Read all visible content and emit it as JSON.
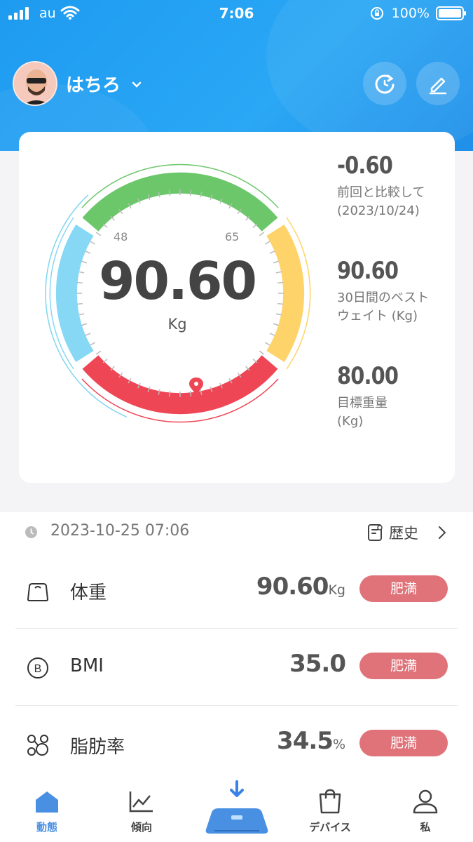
{
  "status": {
    "carrier": "au",
    "time": "7:06",
    "battery": "100%"
  },
  "profile": {
    "name": "はちろ"
  },
  "gauge": {
    "value": "90.60",
    "unit": "Kg",
    "tick_low": "48",
    "tick_high": "65"
  },
  "stats": [
    {
      "value": "-0.60",
      "label_line1": "前回と比較して",
      "label_line2": "(2023/10/24)"
    },
    {
      "value": "90.60",
      "label_line1": "30日間のベスト",
      "label_line2": "ウェイト (Kg)"
    },
    {
      "value": "80.00",
      "label_line1": "目標重量",
      "label_line2": "(Kg)"
    }
  ],
  "record": {
    "datetime": "2023-10-25 07:06",
    "history_label": "歴史"
  },
  "metrics": [
    {
      "name": "体重",
      "value": "90.60",
      "unit": "Kg",
      "badge": "肥満"
    },
    {
      "name": "BMI",
      "value": "35.0",
      "unit": "",
      "badge": "肥満"
    },
    {
      "name": "脂肪率",
      "value": "34.5",
      "unit": "%",
      "badge": "肥満"
    }
  ],
  "tabs": [
    {
      "label": "動態"
    },
    {
      "label": "傾向"
    },
    {
      "label": "デバイス"
    },
    {
      "label": "私"
    }
  ],
  "colors": {
    "accent": "#4a90e2",
    "badge": "#e07279",
    "header": "#1e9bf0"
  }
}
